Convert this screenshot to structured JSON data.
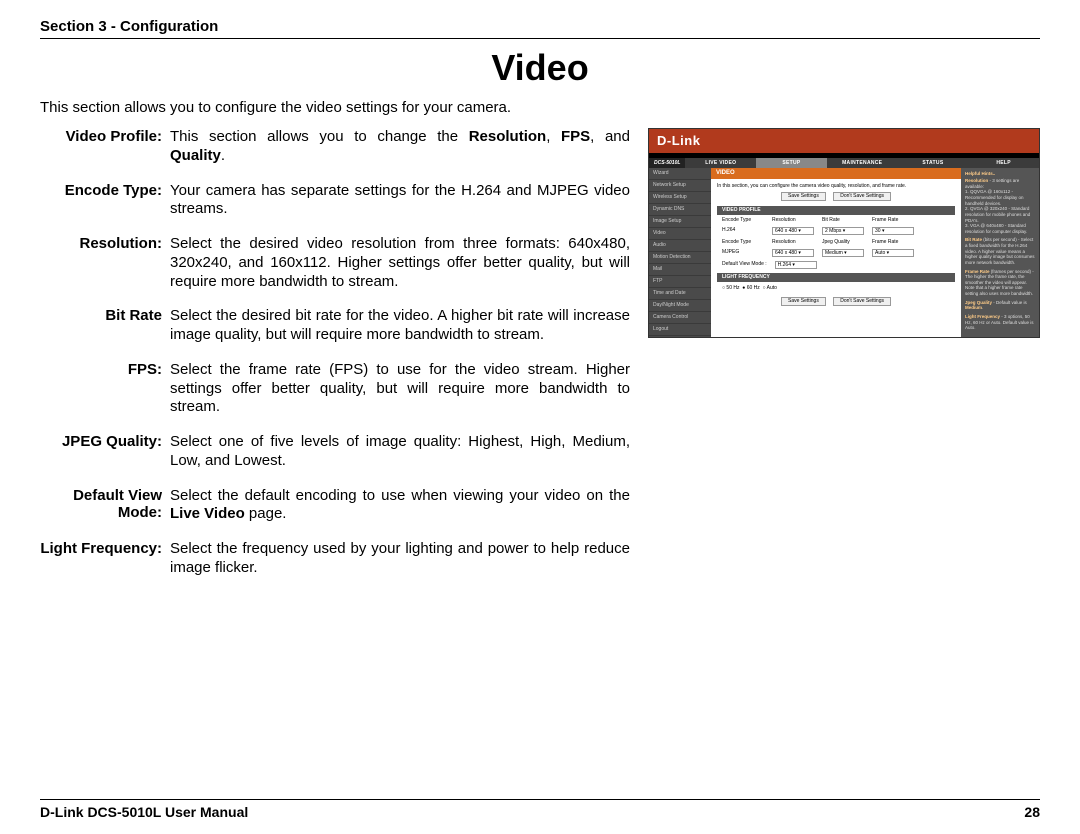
{
  "header": "Section 3 - Configuration",
  "title": "Video",
  "intro": "This section allows you to configure the video settings for your camera.",
  "definitions": [
    {
      "term": "Video Profile:",
      "desc": "This section allows you to change the <b>Resolution</b>, <b>FPS</b>, and <b>Quality</b>."
    },
    {
      "term": "Encode Type:",
      "desc": "Your camera has separate settings for the H.264 and MJPEG video streams."
    },
    {
      "term": "Resolution:",
      "desc": "Select the desired video resolution from three formats: 640x480, 320x240, and 160x112. Higher settings offer better quality, but will require more bandwidth to stream."
    },
    {
      "term": "Bit Rate",
      "desc": "Select the desired bit rate for the video. A higher bit rate will increase image quality, but will require more bandwidth to stream."
    },
    {
      "term": "FPS:",
      "desc": "Select the frame rate (FPS) to use for the video stream. Higher settings offer better quality, but will require more bandwidth to stream."
    },
    {
      "term": "JPEG Quality:",
      "desc": "Select one of five levels of image quality: Highest, High, Medium, Low, and Lowest."
    },
    {
      "term": "Default View Mode:",
      "desc": "Select the default encoding to use when viewing your video on the <b>Live Video</b> page."
    },
    {
      "term": "Light Frequency:",
      "desc": "Select the frequency used by your lighting and power to help reduce image flicker."
    }
  ],
  "screenshot": {
    "brand": "D-Link",
    "model": "DCS-5010L",
    "nav": [
      "LIVE VIDEO",
      "SETUP",
      "MAINTENANCE",
      "STATUS",
      "HELP"
    ],
    "nav_active": 1,
    "sidebar": [
      "Wizard",
      "Network Setup",
      "Wireless Setup",
      "Dynamic DNS",
      "Image Setup",
      "Video",
      "Audio",
      "Motion Detection",
      "Mail",
      "FTP",
      "Time and Date",
      "Day/Night Mode",
      "Camera Control",
      "Logout"
    ],
    "section_title": "VIDEO",
    "section_desc": "In this section, you can configure the camera video quality, resolution, and frame rate.",
    "btn_save": "Save Settings",
    "btn_cancel": "Don't Save Settings",
    "video_profile_label": "VIDEO PROFILE",
    "cols_h264": [
      "Encode Type",
      "Resolution",
      "Bit Rate",
      "Frame Rate"
    ],
    "row_h264_type": "H.264",
    "row_h264_res": "640 x 480",
    "row_h264_bit": "2 Mbps",
    "row_h264_fps": "30",
    "cols_mjpeg": [
      "Encode Type",
      "Resolution",
      "Jpeg Quality",
      "Frame Rate"
    ],
    "row_mjpeg_type": "MJPEG",
    "row_mjpeg_res": "640 x 480",
    "row_mjpeg_q": "Medium",
    "row_mjpeg_fps": "Auto",
    "default_view_label": "Default View Mode :",
    "default_view_value": "H.264",
    "light_freq_label": "LIGHT FREQUENCY",
    "lf_50": "50 Hz",
    "lf_60": "60 Hz",
    "lf_auto": "Auto",
    "help_title": "Helpful Hints..",
    "help_body": [
      "<b>Resolution</b> - 3 settings are available:<br>1. QQVGA @ 160x112 - Recommended for display on handheld devices.<br>2. QVGA @ 320x240 - Standard resolution for mobile phones and PDA's.<br>3. VGA @ 640x480 - Standard resolution for computer display.",
      "<b>Bit Rate</b> (bits per second) - Select a fixed bandwidth for the H.264 video. A higher value means a higher quality image but consumes more network bandwidth.",
      "<b>Frame Rate</b> (frames per second) - The higher the frame rate, the smoother the video will appear. Note that a higher frame rate setting also uses more bandwidth.",
      "<b>Jpeg Quality</b> - Default value is <b>Medium</b>.",
      "<b>Light Frequency</b> - 3 options, 50 Hz, 60 Hz or Auto. Default value is Auto."
    ]
  },
  "footer_left": "D-Link DCS-5010L User Manual",
  "footer_right": "28"
}
